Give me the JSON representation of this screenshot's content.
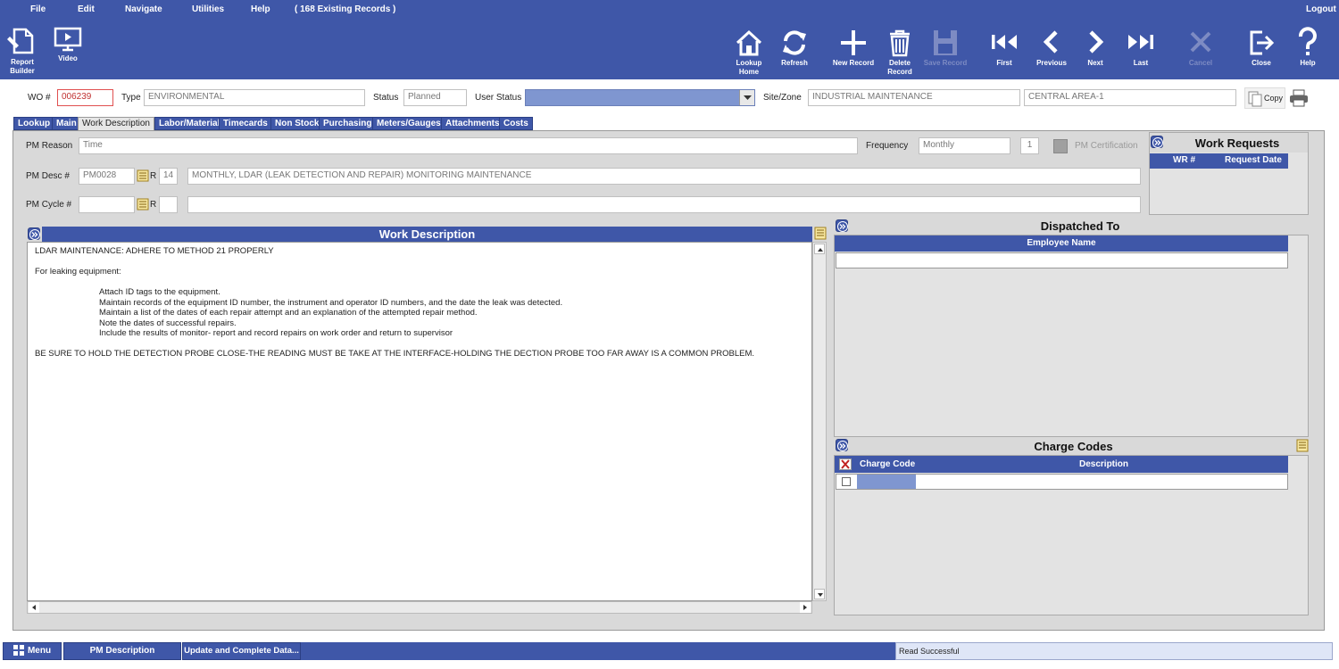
{
  "menu": {
    "file": "File",
    "edit": "Edit",
    "navigate": "Navigate",
    "utilities": "Utilities",
    "help": "Help",
    "records": "( 168 Existing Records )",
    "logout": "Logout"
  },
  "toolbar": {
    "report_builder": "Report Builder",
    "video": "Video",
    "lookup_home": "Lookup Home",
    "refresh": "Refresh",
    "new_record": "New Record",
    "delete_record": "Delete Record",
    "save_record": "Save Record",
    "first": "First",
    "previous": "Previous",
    "next": "Next",
    "last": "Last",
    "cancel": "Cancel",
    "close": "Close",
    "help": "Help"
  },
  "header": {
    "wo_label": "WO #",
    "wo_value": "006239",
    "type_label": "Type",
    "type_value": "ENVIRONMENTAL",
    "status_label": "Status",
    "status_value": "Planned",
    "user_status_label": "User Status",
    "user_status_value": "",
    "site_label": "Site/Zone",
    "site_value": "INDUSTRIAL  MAINTENANCE",
    "zone_value": "CENTRAL AREA-1",
    "copy_label": "Copy"
  },
  "tabs": [
    "Lookup",
    "Main",
    "Work Description",
    "Labor/Material",
    "Timecards",
    "Non Stock",
    "Purchasing",
    "Meters/Gauges",
    "Attachments",
    "Costs"
  ],
  "pm": {
    "reason_label": "PM Reason",
    "reason_value": "Time",
    "frequency_label": "Frequency",
    "frequency_value": "Monthly",
    "frequency_count": "1",
    "certification_label": "PM Certification",
    "desc_label": "PM Desc #",
    "desc_code": "PM0028",
    "desc_r": "R",
    "desc_num": "14",
    "desc_text": "MONTHLY,  LDAR (LEAK DETECTION AND REPAIR) MONITORING MAINTENANCE",
    "cycle_label": "PM Cycle #",
    "cycle_r": "R"
  },
  "work_requests": {
    "title": "Work Requests",
    "col_wr": "WR #",
    "col_date": "Request Date"
  },
  "work_description": {
    "title": "Work Description",
    "line1": "LDAR MAINTENANCE: ADHERE TO METHOD 21 PROPERLY",
    "line2": "For leaking equipment:",
    "bullets": [
      "Attach ID tags to the equipment.",
      "Maintain records of the equipment ID number, the instrument and operator ID numbers, and the date the leak was detected.",
      "Maintain a list of the dates of each repair attempt and an explanation of the attempted repair method.",
      "Note the dates of successful repairs.",
      "Include the results of monitor- report and record repairs on work order and return to supervisor"
    ],
    "line3": "BE SURE TO HOLD THE DETECTION PROBE CLOSE-THE READING MUST BE TAKE AT THE INTERFACE-HOLDING THE DECTION PROBE TOO FAR AWAY IS A COMMON PROBLEM."
  },
  "dispatched": {
    "title": "Dispatched To",
    "col_employee": "Employee Name"
  },
  "charge_codes": {
    "title": "Charge Codes",
    "col_code": "Charge Code",
    "col_desc": "Description"
  },
  "statusbar": {
    "menu": "Menu",
    "pm_description": "PM Description",
    "update": "Update and Complete Data...",
    "message": "Read Successful"
  },
  "colors": {
    "brand_blue": "#3f57a8",
    "panel_grey": "#d9d9d9"
  }
}
